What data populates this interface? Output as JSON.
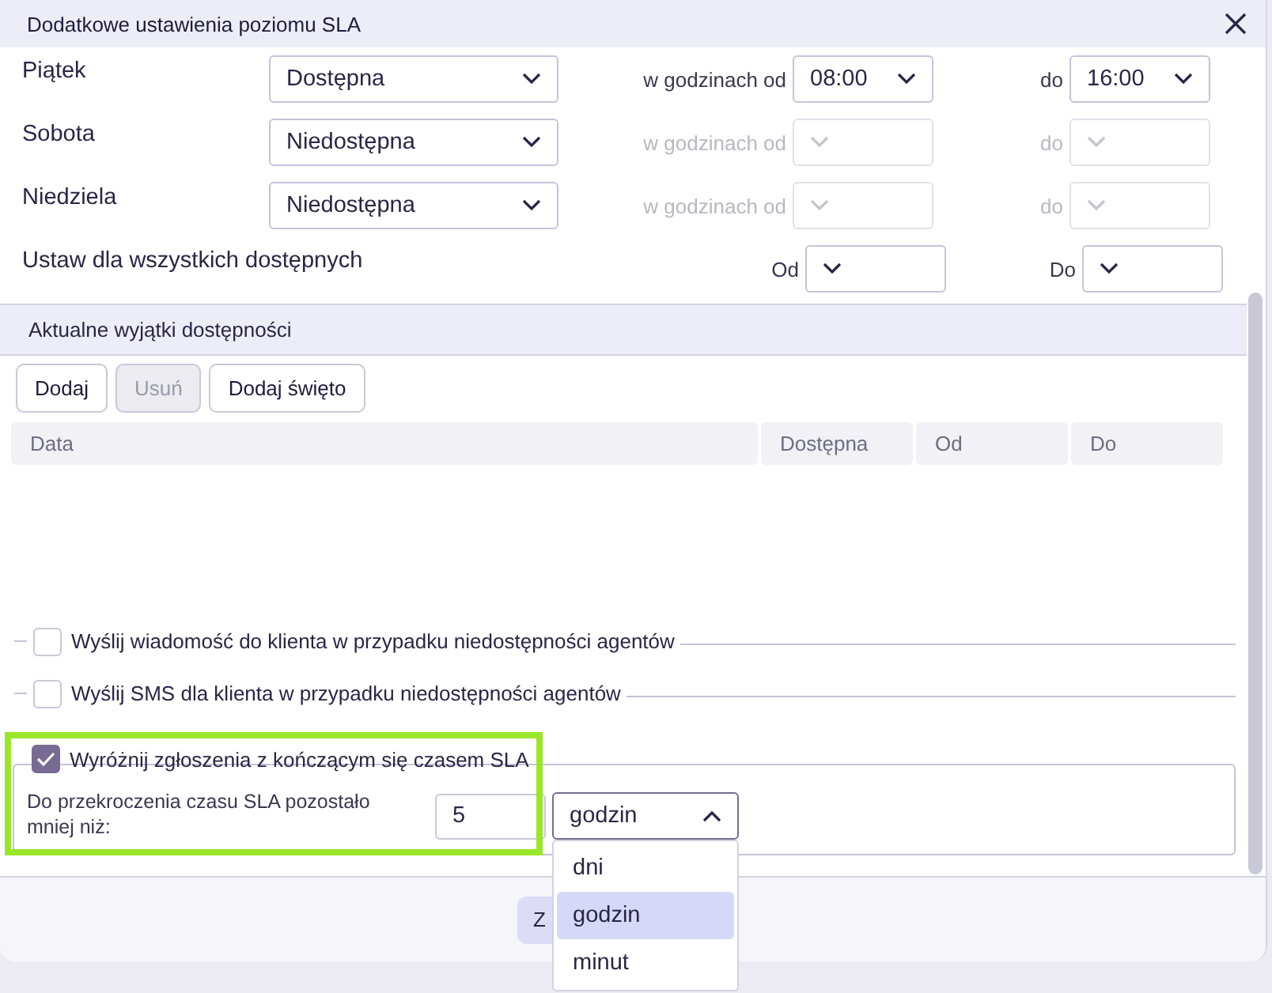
{
  "dialog": {
    "title": "Dodatkowe ustawienia poziomu SLA"
  },
  "days": [
    {
      "name": "Piątek",
      "availability": "Dostępna",
      "from_label": "w godzinach od",
      "from": "08:00",
      "to_label": "do",
      "to": "16:00",
      "disabled": false
    },
    {
      "name": "Sobota",
      "availability": "Niedostępna",
      "from_label": "w godzinach od",
      "to_label": "do",
      "disabled": true
    },
    {
      "name": "Niedziela",
      "availability": "Niedostępna",
      "from_label": "w godzinach od",
      "to_label": "do",
      "disabled": true
    }
  ],
  "set_all": {
    "label": "Ustaw dla wszystkich dostępnych",
    "from_label": "Od",
    "to_label": "Do"
  },
  "exceptions": {
    "title": "Aktualne wyjątki dostępności",
    "buttons": [
      {
        "label": "Dodaj",
        "disabled": false
      },
      {
        "label": "Usuń",
        "disabled": true
      },
      {
        "label": "Dodaj święto",
        "disabled": false
      }
    ],
    "columns": [
      "Data",
      "Dostępna",
      "Od",
      "Do"
    ]
  },
  "options": [
    {
      "label": "Wyślij wiadomość do klienta w przypadku niedostępności agentów",
      "checked": false
    },
    {
      "label": "Wyślij SMS dla klienta w przypadku niedostępności agentów",
      "checked": false
    }
  ],
  "highlight": {
    "label": "Wyróżnij zgłoszenia z kończącym się czasem SLA",
    "checked": true,
    "threshold_label": "Do przekroczenia czasu SLA pozostało mniej niż:",
    "value": "5",
    "unit": "godzin",
    "expanded": true,
    "menu": [
      {
        "label": "dni",
        "selected": false
      },
      {
        "label": "godzin",
        "selected": true
      },
      {
        "label": "minut",
        "selected": false
      }
    ]
  },
  "footer": {
    "button": "Z"
  }
}
